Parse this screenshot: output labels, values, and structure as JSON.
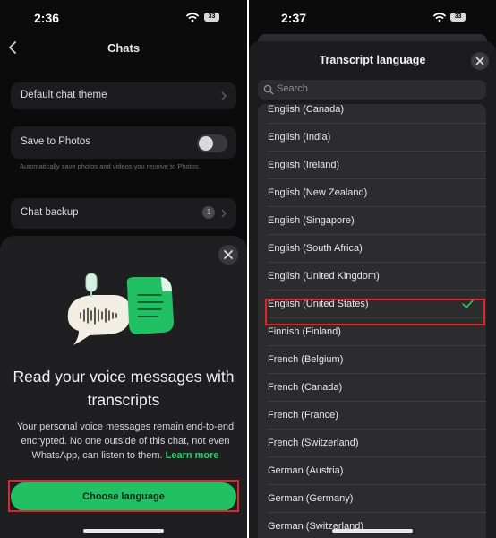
{
  "left": {
    "status": {
      "time": "2:36",
      "battery": "33"
    },
    "nav": {
      "title": "Chats"
    },
    "settings": {
      "theme_label": "Default chat theme",
      "save_photos_label": "Save to Photos",
      "save_photos_caption": "Automatically save photos and videos you receive to Photos.",
      "backup_label": "Chat backup",
      "backup_badge": "1"
    },
    "sheet": {
      "title": "Read your voice messages with transcripts",
      "body": "Your personal voice messages remain end-to-end encrypted. No one outside of this chat, not even WhatsApp, can listen to them.",
      "learn_more": "Learn more",
      "cta_label": "Choose language"
    }
  },
  "right": {
    "status": {
      "time": "2:37",
      "battery": "33"
    },
    "modal": {
      "title": "Transcript language",
      "search_placeholder": "Search"
    },
    "languages": [
      {
        "label": "English (Canada)",
        "selected": false
      },
      {
        "label": "English (India)",
        "selected": false
      },
      {
        "label": "English (Ireland)",
        "selected": false
      },
      {
        "label": "English (New Zealand)",
        "selected": false
      },
      {
        "label": "English (Singapore)",
        "selected": false
      },
      {
        "label": "English (South Africa)",
        "selected": false
      },
      {
        "label": "English (United Kingdom)",
        "selected": false
      },
      {
        "label": "English (United States)",
        "selected": true
      },
      {
        "label": "Finnish (Finland)",
        "selected": false
      },
      {
        "label": "French (Belgium)",
        "selected": false
      },
      {
        "label": "French (Canada)",
        "selected": false
      },
      {
        "label": "French (France)",
        "selected": false
      },
      {
        "label": "French (Switzerland)",
        "selected": false
      },
      {
        "label": "German (Austria)",
        "selected": false
      },
      {
        "label": "German (Germany)",
        "selected": false
      },
      {
        "label": "German (Switzerland)",
        "selected": false
      }
    ]
  },
  "colors": {
    "accent_green": "#25d366",
    "button_green": "#21c063",
    "highlight_red": "#e0252b",
    "background": "#0b0b0b"
  }
}
